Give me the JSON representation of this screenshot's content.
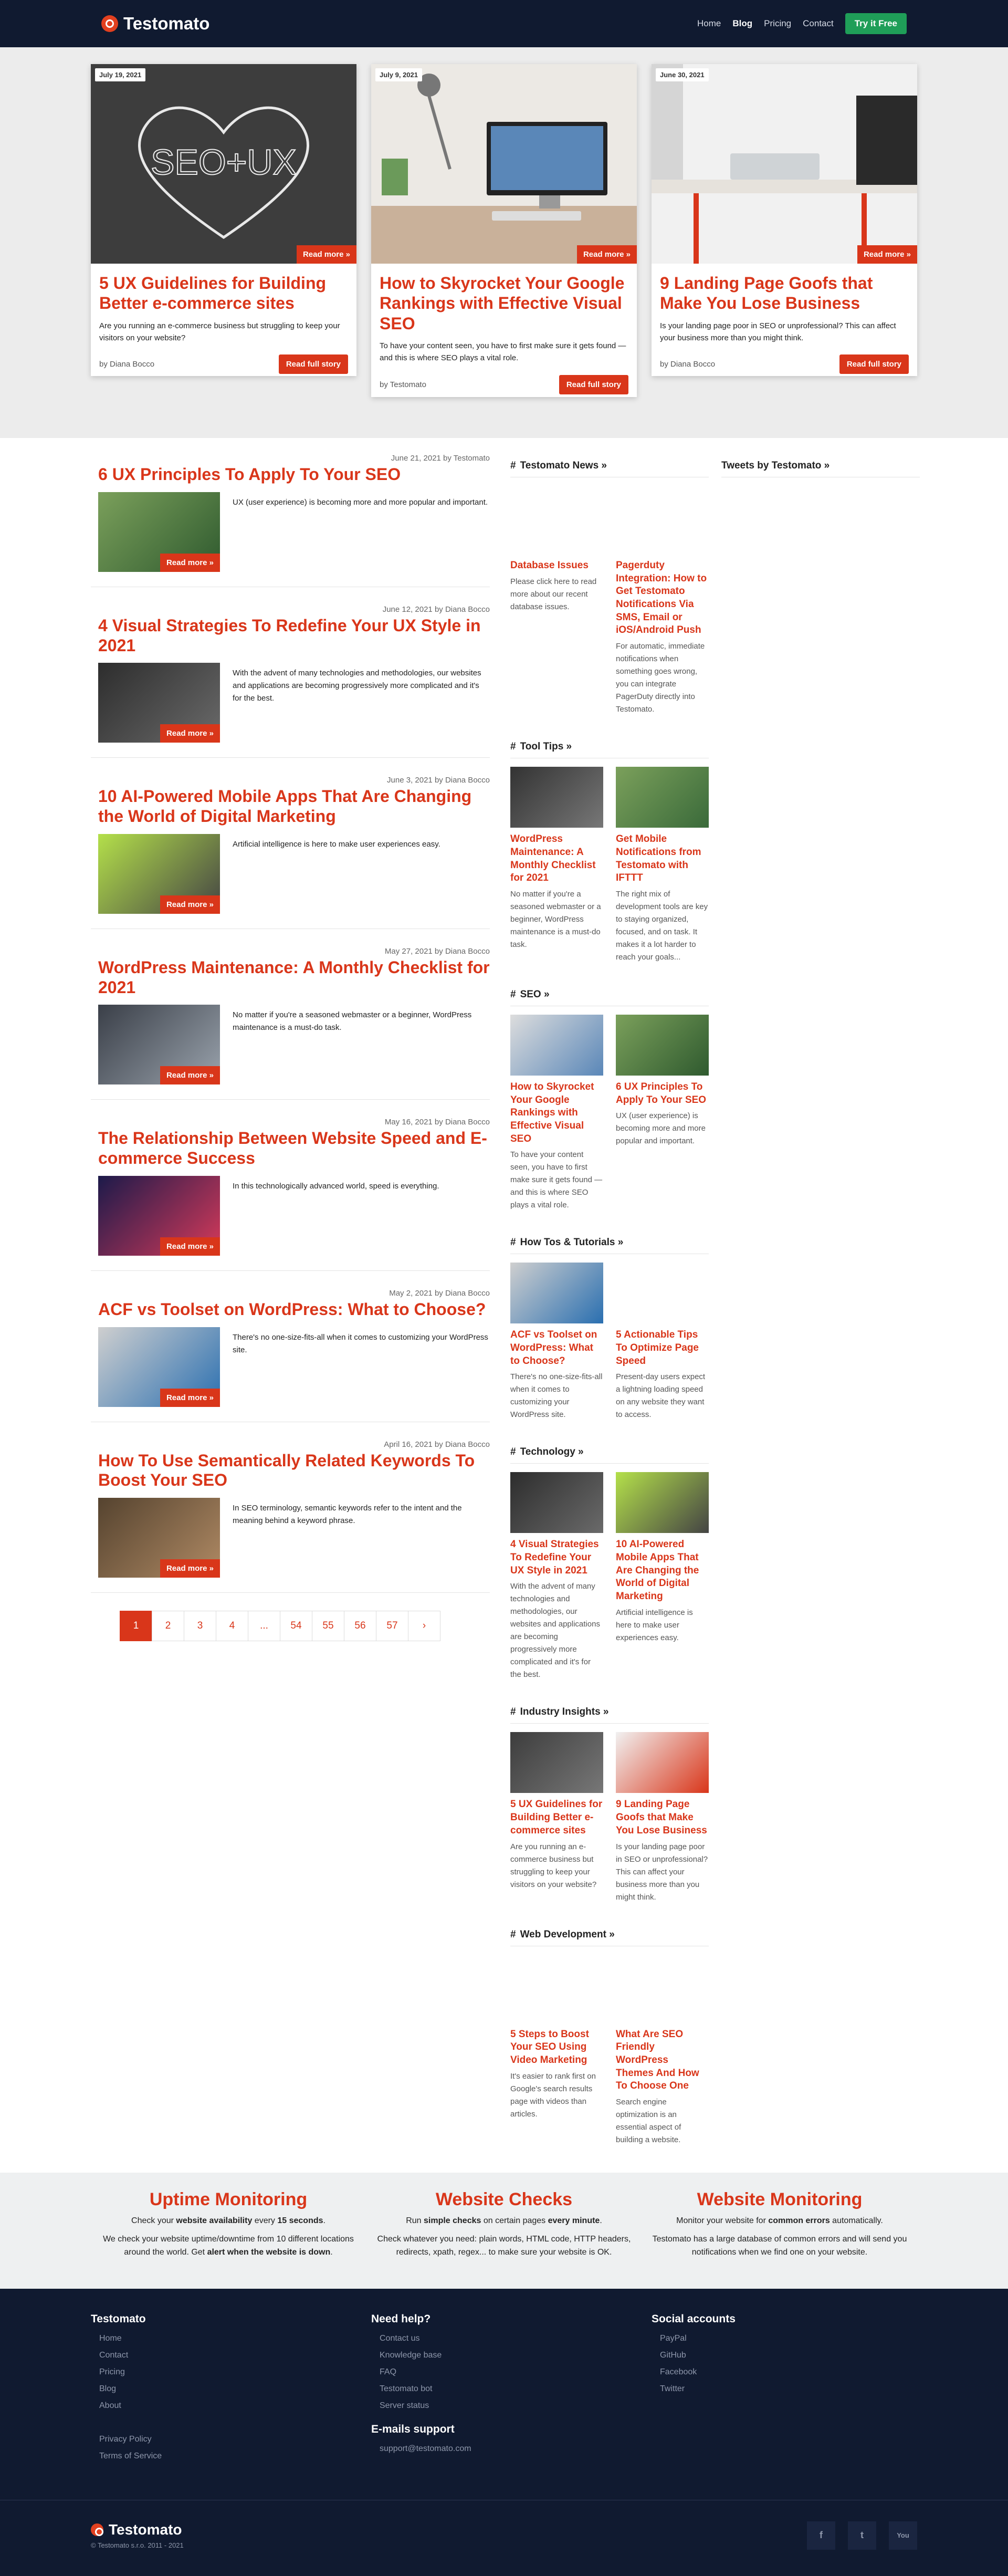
{
  "nav": {
    "brand": "Testomato",
    "links": [
      "Home",
      "Blog",
      "Pricing",
      "Contact"
    ],
    "cta": "Try it Free"
  },
  "featured": [
    {
      "date": "July 19, 2021",
      "title": "5 UX Guidelines for Building Better e-commerce sites",
      "excerpt": "Are you running an e-commerce business but struggling to keep your visitors on your website?",
      "by": "by Diana Bocco",
      "img_text": "SEO+UX"
    },
    {
      "date": "July 9, 2021",
      "title": "How to Skyrocket Your Google Rankings with Effective Visual SEO",
      "excerpt": "To have your content seen, you have to first make sure it gets found —and this is where SEO plays a vital role.",
      "by": "by Testomato"
    },
    {
      "date": "June 30, 2021",
      "title": "9 Landing Page Goofs that Make You Lose Business",
      "excerpt": "Is your landing page poor in SEO or unprofessional? This can affect your business more than you might think.",
      "by": "by Diana Bocco"
    }
  ],
  "labels": {
    "read_more": "Read more »",
    "read_full": "Read full story"
  },
  "posts": [
    {
      "meta": "June 21, 2021 by Testomato",
      "title": "6 UX Principles To Apply To Your SEO",
      "excerpt": "UX (user experience) is becoming more and more popular and important."
    },
    {
      "meta": "June 12, 2021 by Diana Bocco",
      "title": "4 Visual Strategies To Redefine Your UX Style in 2021",
      "excerpt": "With the advent of many technologies and methodologies, our websites and applications are becoming progressively more complicated and it's for the best."
    },
    {
      "meta": "June 3, 2021 by Diana Bocco",
      "title": "10 AI-Powered Mobile Apps That Are Changing the World of Digital Marketing",
      "excerpt": "Artificial intelligence is here to make user experiences easy."
    },
    {
      "meta": "May 27, 2021 by Diana Bocco",
      "title": "WordPress Maintenance: A Monthly Checklist for 2021",
      "excerpt": "No matter if you're a seasoned webmaster or a beginner, WordPress maintenance is a must-do task."
    },
    {
      "meta": "May 16, 2021 by Diana Bocco",
      "title": "The Relationship Between Website Speed and E-commerce Success",
      "excerpt": "In this technologically advanced world, speed is everything."
    },
    {
      "meta": "May 2, 2021 by Diana Bocco",
      "title": "ACF vs Toolset on WordPress: What to Choose?",
      "excerpt": "There's no one-size-fits-all when it comes to customizing your WordPress site."
    },
    {
      "meta": "April 16, 2021 by Diana Bocco",
      "title": "How To Use Semantically Related Keywords To Boost Your SEO",
      "excerpt": "In SEO terminology, semantic keywords refer to the intent and the meaning behind a keyword phrase."
    }
  ],
  "pagination": [
    "1",
    "2",
    "3",
    "4",
    "...",
    "54",
    "55",
    "56",
    "57",
    "›"
  ],
  "sidebar": {
    "sections": [
      {
        "head": "Testomato News »",
        "items": [
          {
            "title": "Database Issues",
            "excerpt": "Please click here to read more about our recent database issues."
          },
          {
            "title": "Pagerduty Integration: How to Get Testomato Notifications Via SMS, Email or iOS/Android Push",
            "excerpt": "For automatic, immediate notifications when something goes wrong, you can integrate PagerDuty directly into Testomato."
          }
        ]
      },
      {
        "head": "Tool Tips »",
        "items": [
          {
            "title": "WordPress Maintenance: A Monthly Checklist for 2021",
            "excerpt": "No matter if you're a seasoned webmaster or a beginner, WordPress maintenance is a must-do task."
          },
          {
            "title": "Get Mobile Notifications from Testomato with IFTTT",
            "excerpt": "The right mix of development tools are key to staying organized, focused, and on task. It makes it a lot harder to reach your goals..."
          }
        ]
      },
      {
        "head": "SEO »",
        "items": [
          {
            "title": "How to Skyrocket Your Google Rankings with Effective Visual SEO",
            "excerpt": "To have your content seen, you have to first make sure it gets found —and this is where SEO plays a vital role."
          },
          {
            "title": "6 UX Principles To Apply To Your SEO",
            "excerpt": "UX (user experience) is becoming more and more popular and important."
          }
        ]
      },
      {
        "head": "How Tos & Tutorials »",
        "items": [
          {
            "title": "ACF vs Toolset on WordPress: What to Choose?",
            "excerpt": "There's no one-size-fits-all when it comes to customizing your WordPress site."
          },
          {
            "title": "5 Actionable Tips To Optimize Page Speed",
            "excerpt": "Present-day users expect a lightning loading speed on any website they want to access."
          }
        ]
      },
      {
        "head": "Technology »",
        "items": [
          {
            "title": "4 Visual Strategies To Redefine Your UX Style in 2021",
            "excerpt": "With the advent of many technologies and methodologies, our websites and applications are becoming progressively more complicated and it's for the best."
          },
          {
            "title": "10 AI-Powered Mobile Apps That Are Changing the World of Digital Marketing",
            "excerpt": "Artificial intelligence is here to make user experiences easy."
          }
        ]
      },
      {
        "head": "Industry Insights »",
        "items": [
          {
            "title": "5 UX Guidelines for Building Better e-commerce sites",
            "excerpt": "Are you running an e-commerce business but struggling to keep your visitors on your website?"
          },
          {
            "title": "9 Landing Page Goofs that Make You Lose Business",
            "excerpt": "Is your landing page poor in SEO or unprofessional? This can affect your business more than you might think."
          }
        ]
      },
      {
        "head": "Web Development »",
        "items": [
          {
            "title": "5 Steps to Boost Your SEO Using Video Marketing",
            "excerpt": "It's easier to rank first on Google's search results page with videos than articles."
          },
          {
            "title": "What Are SEO Friendly WordPress Themes And How To Choose One",
            "excerpt": "Search engine optimization is an essential aspect of building a website."
          }
        ]
      }
    ],
    "tweets_head": "Tweets by Testomato »"
  },
  "features": [
    {
      "title": "Uptime Monitoring",
      "l1a": "Check your ",
      "l1b": "website availability",
      "l1c": " every ",
      "l1d": "15 seconds",
      "l1e": ".",
      "l2a": "We check your website uptime/downtime from 10 different locations around the world. Get ",
      "l2b": "alert when the website is down",
      "l2c": "."
    },
    {
      "title": "Website Checks",
      "l1a": "Run ",
      "l1b": "simple checks",
      "l1c": " on certain pages ",
      "l1d": "every minute",
      "l1e": ".",
      "l2a": "Check whatever you need: plain words, HTML code, HTTP headers, redirects, xpath, regex... to make sure your website is OK.",
      "l2b": "",
      "l2c": ""
    },
    {
      "title": "Website Monitoring",
      "l1a": "Monitor your website for ",
      "l1b": "common errors",
      "l1c": " automatically.",
      "l1d": "",
      "l1e": "",
      "l2a": "Testomato has a large database of common errors and will send you notifications when we find one on your website.",
      "l2b": "",
      "l2c": ""
    }
  ],
  "footer": {
    "col1": {
      "head": "Testomato",
      "links": [
        "Home",
        "Contact",
        "Pricing",
        "Blog",
        "About"
      ],
      "links2": [
        "Privacy Policy",
        "Terms of Service"
      ]
    },
    "col2": {
      "head": "Need help?",
      "links": [
        "Contact us",
        "Knowledge base",
        "FAQ",
        "Testomato bot",
        "Server status"
      ],
      "head2": "E-mails support",
      "email": "support@testomato.com"
    },
    "col3": {
      "head": "Social accounts",
      "links": [
        "PayPal",
        "GitHub",
        "Facebook",
        "Twitter"
      ]
    },
    "brand": "Testomato",
    "copyright": "© Testomato s.r.o. 2011 - 2021",
    "social": [
      "f",
      "t",
      "You"
    ]
  }
}
